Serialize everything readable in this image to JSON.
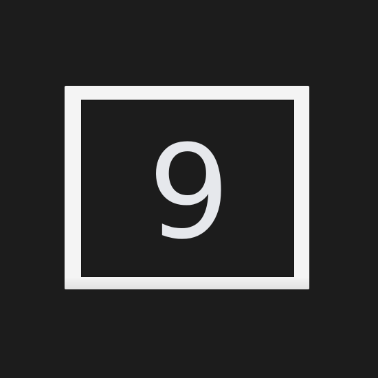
{
  "icon": {
    "name": "number-9-icon",
    "digit": "9"
  },
  "colors": {
    "background": "#1c1c1c",
    "frame": "#f4f4f4",
    "digit": "#e6e8ec"
  }
}
